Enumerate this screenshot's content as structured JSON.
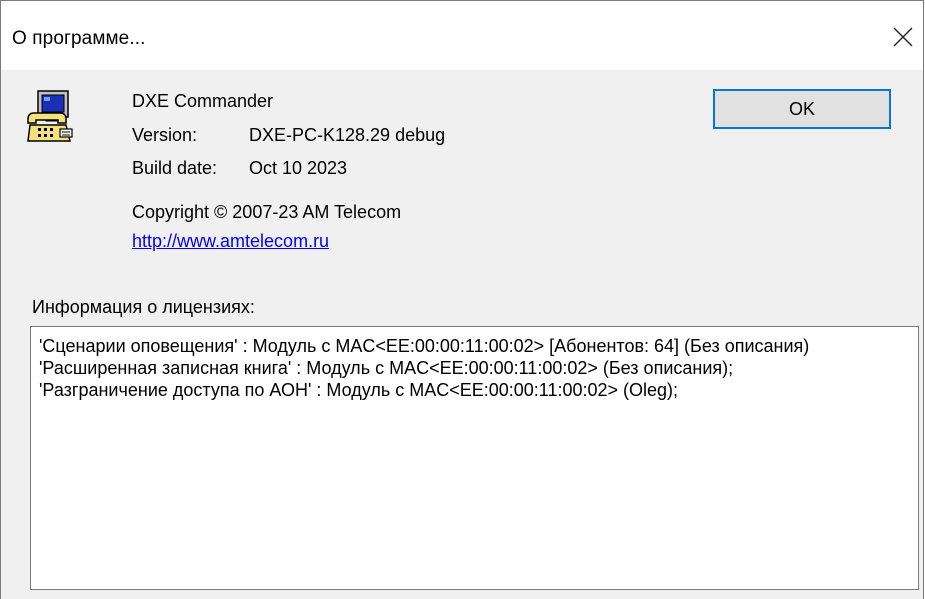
{
  "window": {
    "title": "О программе...",
    "close_glyph": "×"
  },
  "app": {
    "icon": "telephone-computer-icon",
    "name": "DXE Commander",
    "version_label": "Version:",
    "version_value": "DXE-PC-K128.29 debug",
    "build_label": "Build date:",
    "build_value": "Oct 10 2023",
    "copyright": "Copyright © 2007-23 AM Telecom",
    "website": "http://www.amtelecom.ru"
  },
  "buttons": {
    "ok_label": "OK"
  },
  "license": {
    "heading": "Информация о лицензиях:",
    "lines": [
      "'Сценарии оповещения' : Модуль с MAC<EE:00:00:11:00:02> [Абонентов: 64] (Без описания)",
      "'Расширенная записная книга' : Модуль с MAC<EE:00:00:11:00:02> (Без описания);",
      "'Разграничение доступа по АОН' : Модуль с MAC<EE:00:00:11:00:02> (Oleg);"
    ]
  },
  "colors": {
    "window_bg": "#f0f0f0",
    "titlebar_bg": "#ffffff",
    "link": "#0000ff",
    "button_focus_border": "#0078d7"
  }
}
